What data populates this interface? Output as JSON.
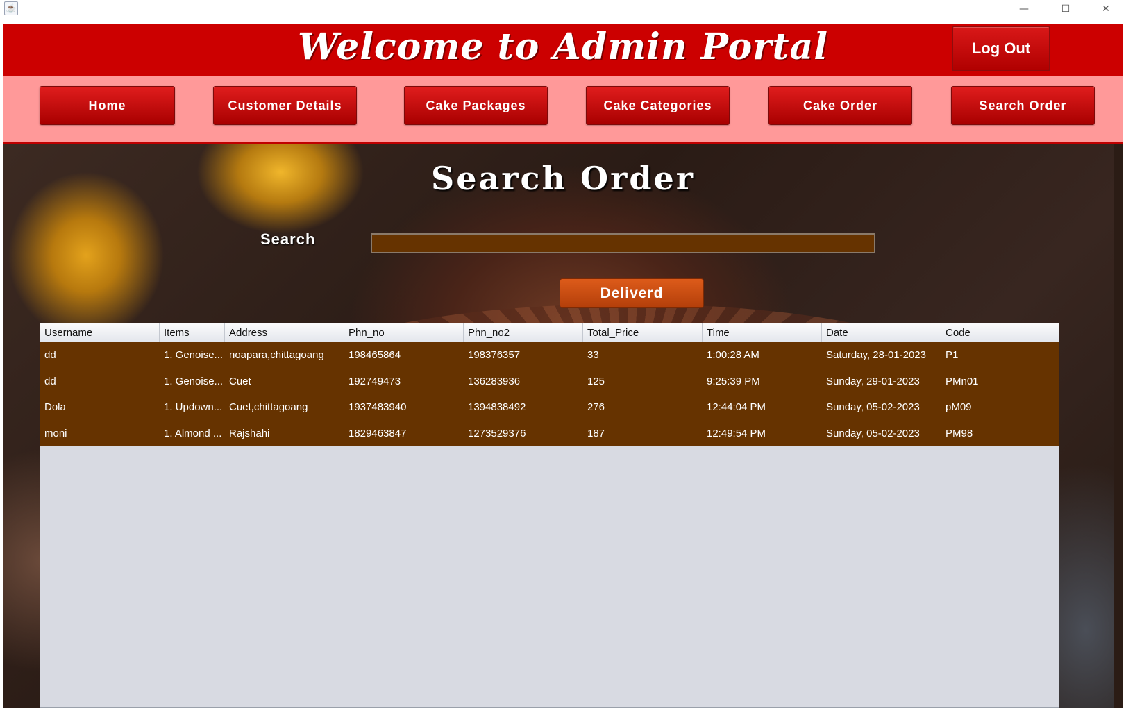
{
  "window": {
    "minimize": "—",
    "maximize": "☐",
    "close": "✕",
    "app_icon": "java-icon"
  },
  "header": {
    "title": "Welcome to  Admin Portal",
    "logout_label": "Log Out"
  },
  "nav": {
    "items": [
      {
        "label": "Home"
      },
      {
        "label": "Customer Details"
      },
      {
        "label": "Cake Packages"
      },
      {
        "label": "Cake Categories"
      },
      {
        "label": "Cake Order"
      },
      {
        "label": "Search Order"
      }
    ]
  },
  "main": {
    "title": "Search Order",
    "search_label": "Search",
    "search_value": "",
    "deliverd_label": "Deliverd"
  },
  "table": {
    "columns": [
      "Username",
      "Items",
      "Address",
      "Phn_no",
      "Phn_no2",
      "Total_Price",
      "Time",
      "Date",
      "Code"
    ],
    "rows": [
      [
        "dd",
        "1. Genoise...",
        "noapara,chittagoang",
        "198465864",
        "198376357",
        "33",
        "1:00:28 AM",
        "Saturday, 28-01-2023",
        "P1"
      ],
      [
        "dd",
        "1. Genoise...",
        "Cuet",
        "192749473",
        "136283936",
        "125",
        "9:25:39 PM",
        "Sunday, 29-01-2023",
        "PMn01"
      ],
      [
        "Dola",
        "1. Updown...",
        "Cuet,chittagoang",
        "1937483940",
        "1394838492",
        "276",
        "12:44:04 PM",
        "Sunday, 05-02-2023",
        "pM09"
      ],
      [
        "moni",
        "1. Almond ...",
        "Rajshahi",
        "1829463847",
        "1273529376",
        "187",
        "12:49:54 PM",
        "Sunday, 05-02-2023",
        "PM98"
      ]
    ]
  },
  "colors": {
    "header_red": "#cc0000",
    "nav_pink": "#ff9999",
    "row_brown": "#663300",
    "deliverd_orange": "#cc4c12"
  }
}
